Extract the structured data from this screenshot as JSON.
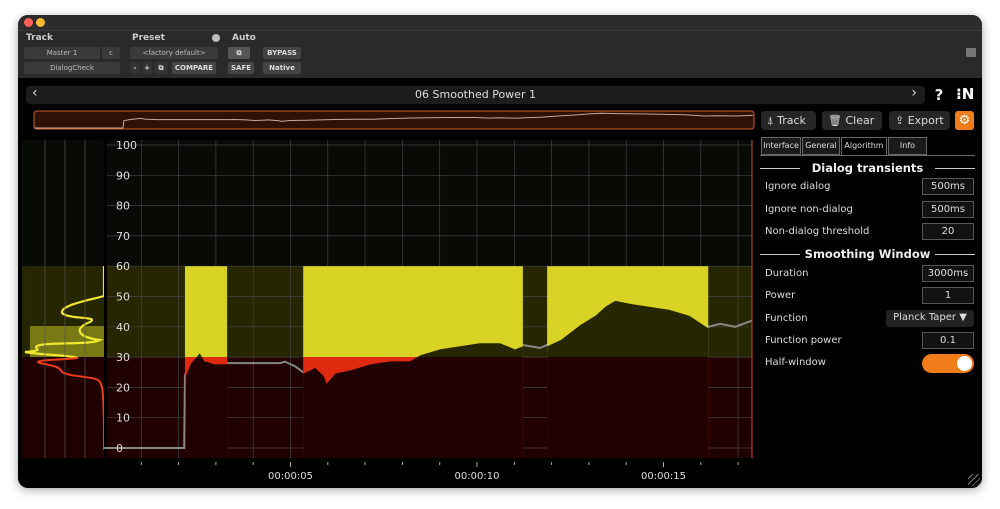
{
  "header": {
    "track_label": "Track",
    "preset_label": "Preset",
    "auto_label": "Auto",
    "track_select": "Master 1",
    "channel_select": "c",
    "plugin_select": "DialogCheck",
    "preset_select": "<factory default>",
    "minus": "-",
    "plus": "+",
    "compare": "COMPARE",
    "bypass": "BYPASS",
    "safe": "SAFE",
    "native": "Native"
  },
  "nav": {
    "title": "06 Smoothed Power 1",
    "prev": "‹",
    "next": "›",
    "help": "?",
    "logo": "N"
  },
  "toolbar": {
    "track": "Track",
    "clear": "Clear",
    "export": "Export"
  },
  "tabs": [
    {
      "label": "Interface"
    },
    {
      "label": "General"
    },
    {
      "label": "Algorithm",
      "active": true
    },
    {
      "label": "Info"
    }
  ],
  "sections": {
    "dialog_transients": {
      "title": "Dialog transients",
      "rows": [
        {
          "label": "Ignore dialog",
          "value": "500ms"
        },
        {
          "label": "Ignore non-dialog",
          "value": "500ms"
        },
        {
          "label": "Non-dialog threshold",
          "value": "20"
        }
      ]
    },
    "smoothing_window": {
      "title": "Smoothing Window",
      "rows": [
        {
          "label": "Duration",
          "value": "3000ms"
        },
        {
          "label": "Power",
          "value": "1"
        },
        {
          "label": "Function",
          "value": "Planck Taper ▼"
        },
        {
          "label": "Function power",
          "value": "0.1"
        },
        {
          "label": "Half-window",
          "value": true
        }
      ]
    }
  },
  "colors": {
    "accent": "#f07c1a",
    "dialog": "#d8d325",
    "below_threshold": "#e02a10",
    "nondialog_line": "#888888"
  },
  "chart_data": {
    "type": "line",
    "ylim": [
      0,
      100
    ],
    "xlim": [
      0,
      17.4
    ],
    "yticks": [
      "0",
      "10",
      "20",
      "30",
      "40",
      "50",
      "60",
      "70",
      "80",
      "90",
      "100"
    ],
    "xtick_labels": [
      {
        "t": 5,
        "label": "00:00:05"
      },
      {
        "t": 10,
        "label": "00:00:10"
      },
      {
        "t": 15,
        "label": "00:00:15"
      }
    ],
    "threshold": 30,
    "upper_band": 60,
    "dialog_segments": [
      [
        2.17,
        3.3
      ],
      [
        5.34,
        11.23
      ],
      [
        11.88,
        16.2
      ]
    ],
    "points": [
      [
        0,
        0
      ],
      [
        2.15,
        0
      ],
      [
        2.17,
        24
      ],
      [
        2.3,
        28
      ],
      [
        2.44,
        30
      ],
      [
        2.57,
        32
      ],
      [
        2.71,
        29
      ],
      [
        2.98,
        28
      ],
      [
        3.3,
        28
      ],
      [
        4.72,
        28
      ],
      [
        4.85,
        28.5
      ],
      [
        5.12,
        27
      ],
      [
        5.34,
        25
      ],
      [
        5.52,
        26
      ],
      [
        5.66,
        27
      ],
      [
        5.92,
        24
      ],
      [
        5.98,
        22
      ],
      [
        6.19,
        25
      ],
      [
        6.6,
        26
      ],
      [
        7.13,
        28
      ],
      [
        7.67,
        29
      ],
      [
        8.2,
        29
      ],
      [
        8.47,
        31
      ],
      [
        9.01,
        33
      ],
      [
        9.54,
        34
      ],
      [
        10.08,
        35
      ],
      [
        10.62,
        35
      ],
      [
        11.02,
        33
      ],
      [
        11.23,
        34
      ],
      [
        11.69,
        33
      ],
      [
        11.88,
        34
      ],
      [
        12.23,
        36
      ],
      [
        12.76,
        41
      ],
      [
        13.16,
        44
      ],
      [
        13.43,
        47
      ],
      [
        13.7,
        49
      ],
      [
        14.1,
        48
      ],
      [
        14.64,
        47
      ],
      [
        15.17,
        46
      ],
      [
        15.71,
        44
      ],
      [
        16.2,
        40
      ],
      [
        16.52,
        41
      ],
      [
        16.92,
        40
      ],
      [
        17.37,
        42
      ]
    ]
  }
}
